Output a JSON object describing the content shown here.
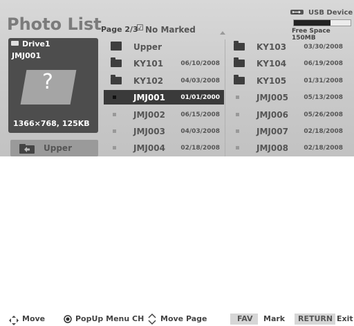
{
  "header": {
    "title": "Photo List",
    "page_info": "Page 2/3",
    "marked_check": "☑",
    "marked_text": "No Marked",
    "usb_label": "USB Device",
    "free_space": "Free Space 150MB",
    "free_space_used_fraction": 0.65
  },
  "preview": {
    "drive": "Drive1",
    "file": "JMJ001",
    "thumbnail_symbol": "?",
    "resolution": "1366×768, 125KB"
  },
  "upper_button": {
    "label": "Upper"
  },
  "list": {
    "left": [
      {
        "type": "updir",
        "name": "Upper",
        "date": ""
      },
      {
        "type": "folder",
        "name": "KY101",
        "date": "06/10/2008"
      },
      {
        "type": "folder",
        "name": "KY102",
        "date": "04/03/2008"
      },
      {
        "type": "photo",
        "name": "JMJ001",
        "date": "01/01/2000",
        "selected": true
      },
      {
        "type": "photo",
        "name": "JMJ002",
        "date": "06/15/2008"
      },
      {
        "type": "photo",
        "name": "JMJ003",
        "date": "04/03/2008"
      },
      {
        "type": "photo",
        "name": "JMJ004",
        "date": "02/18/2008"
      }
    ],
    "right": [
      {
        "type": "folder",
        "name": "KY103",
        "date": "03/30/2008"
      },
      {
        "type": "folder",
        "name": "KY104",
        "date": "06/19/2008"
      },
      {
        "type": "folder",
        "name": "KY105",
        "date": "01/31/2008"
      },
      {
        "type": "photo",
        "name": "JMJ005",
        "date": "05/13/2008"
      },
      {
        "type": "photo",
        "name": "JMJ006",
        "date": "05/26/2008"
      },
      {
        "type": "photo",
        "name": "JMJ007",
        "date": "02/18/2008"
      },
      {
        "type": "photo",
        "name": "JMJ008",
        "date": "02/18/2008"
      }
    ]
  },
  "footer": {
    "move": "Move",
    "popup": "PopUp Menu",
    "ch": "CH",
    "move_page": "Move Page",
    "fav_key": "FAV",
    "mark": "Mark",
    "return_key": "RETURN",
    "exit": "Exit"
  },
  "icons": {
    "move": "four-way-arrow-icon",
    "popup": "ok-button-icon",
    "page": "up-down-chevron-icon",
    "usb": "usb-icon"
  }
}
